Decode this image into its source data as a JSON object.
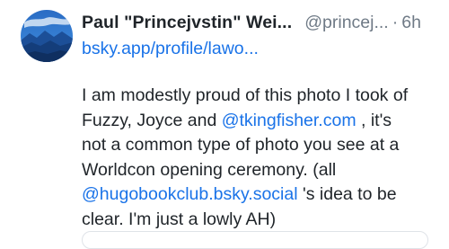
{
  "post": {
    "author": {
      "display_name": "Paul \"Princejvstin\" Wei...",
      "handle": "@princej...",
      "avatar": "avatar-mountain-landscape"
    },
    "separator": "·",
    "age": "6h",
    "link": "bsky.app/profile/lawo...",
    "body": {
      "line1": "I am modestly proud of this photo I took of",
      "line2_before": "Fuzzy, Joyce and ",
      "line2_mention": "@tkingfisher.com",
      "line2_after": " , it's",
      "line3": "not a common type of photo you see at a",
      "line4": "Worldcon opening ceremony.  (all",
      "line5_mention": "@hugobookclub.bsky.social",
      "line5_after": " 's idea to be",
      "line6": "clear. I'm just a lowly AH)"
    },
    "colors": {
      "link": "#1a73e8",
      "text": "#1f2429",
      "muted": "#6f7a86"
    }
  }
}
